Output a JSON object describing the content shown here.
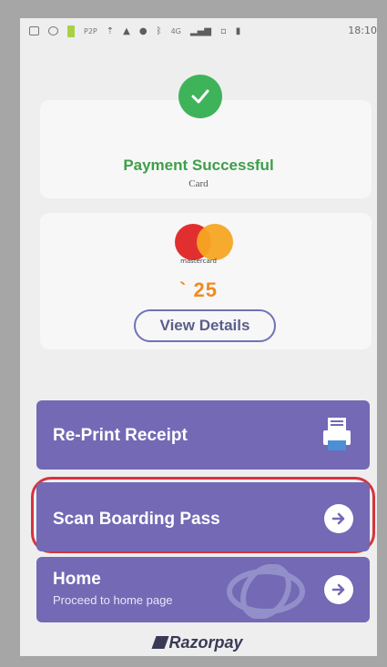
{
  "statusbar": {
    "time": "18:10",
    "network": "4G",
    "p2p": "P2P"
  },
  "payment": {
    "title": "Payment Successful",
    "method": "Card"
  },
  "card": {
    "brand_text": "mastercard",
    "amount": "` 25",
    "view_details_label": "View Details"
  },
  "actions": {
    "reprint_label": "Re-Print Receipt",
    "scan_label": "Scan Boarding Pass",
    "home_label": "Home",
    "home_sub": "Proceed to home page"
  },
  "footer": {
    "brand": "Razorpay"
  },
  "colors": {
    "success_green": "#3fb35a",
    "action_purple": "#7369b5",
    "amount_orange": "#f08a24",
    "highlight_red": "#d6333d"
  }
}
